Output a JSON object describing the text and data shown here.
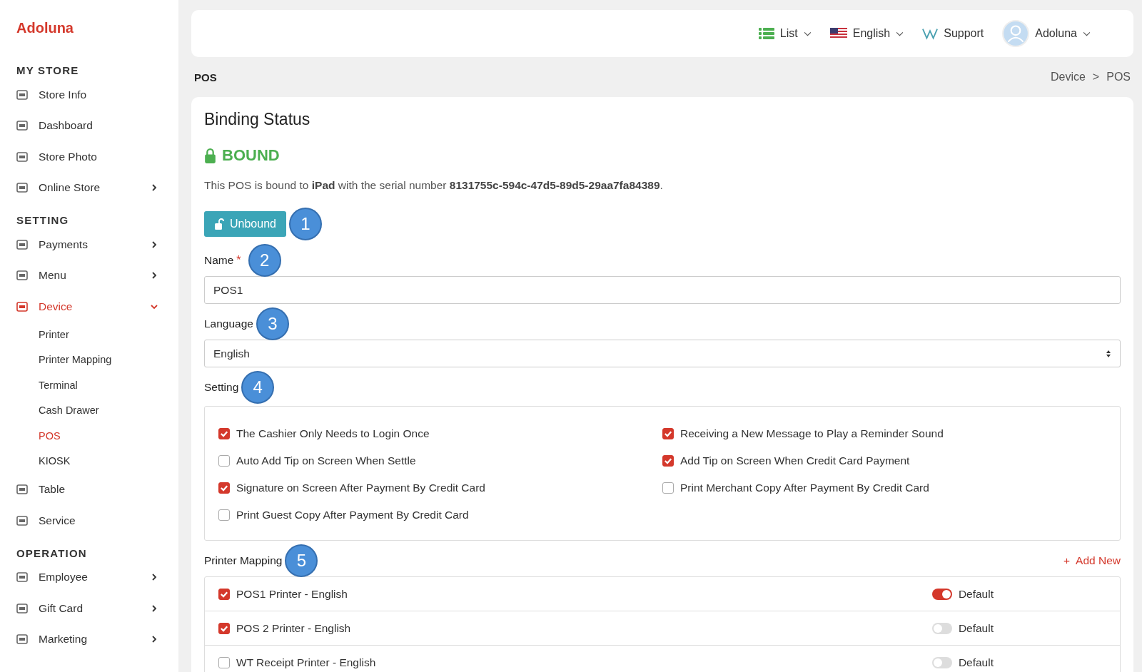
{
  "brand": "Adoluna",
  "sidebar": [
    {
      "kind": "section",
      "label": "MY STORE"
    },
    {
      "kind": "item",
      "label": "Store Info",
      "chevron": false,
      "selected": false
    },
    {
      "kind": "item",
      "label": "Dashboard",
      "chevron": false,
      "selected": false
    },
    {
      "kind": "item",
      "label": "Store Photo",
      "chevron": false,
      "selected": false
    },
    {
      "kind": "item",
      "label": "Online Store",
      "chevron": true,
      "expanded": false,
      "selected": false
    },
    {
      "kind": "section",
      "label": "SETTING"
    },
    {
      "kind": "item",
      "label": "Payments",
      "chevron": true,
      "expanded": false,
      "selected": false
    },
    {
      "kind": "item",
      "label": "Menu",
      "chevron": true,
      "expanded": false,
      "selected": false
    },
    {
      "kind": "item",
      "label": "Device",
      "chevron": true,
      "expanded": true,
      "selected": true,
      "children": [
        {
          "label": "Printer",
          "selected": false
        },
        {
          "label": "Printer Mapping",
          "selected": false
        },
        {
          "label": "Terminal",
          "selected": false
        },
        {
          "label": "Cash Drawer",
          "selected": false
        },
        {
          "label": "POS",
          "selected": true
        },
        {
          "label": "KIOSK",
          "selected": false
        }
      ]
    },
    {
      "kind": "item",
      "label": "Table",
      "chevron": false,
      "selected": false
    },
    {
      "kind": "item",
      "label": "Service",
      "chevron": false,
      "selected": false
    },
    {
      "kind": "section",
      "label": "OPERATION"
    },
    {
      "kind": "item",
      "label": "Employee",
      "chevron": true,
      "expanded": false,
      "selected": false
    },
    {
      "kind": "item",
      "label": "Gift Card",
      "chevron": true,
      "expanded": false,
      "selected": false
    },
    {
      "kind": "item",
      "label": "Marketing",
      "chevron": true,
      "expanded": false,
      "selected": false
    }
  ],
  "topbar": {
    "view": "List",
    "language": "English",
    "support": "Support",
    "user": "Adoluna"
  },
  "page_title": "POS",
  "breadcrumb": [
    "Device",
    ">",
    "POS"
  ],
  "card": {
    "title": "Binding Status",
    "status": "BOUND",
    "description": "This POS is bound to **iPad** with the serial number **8131755c-594c-47d5-89d5-29aa7fa84389**.",
    "unbind_button": "Unbound",
    "unbind_callout": "1",
    "name_label": "Name",
    "name_required": "*",
    "name_callout": "2",
    "name_value": "POS1",
    "language_label": "Language",
    "language_callout": "3",
    "language_value": "English",
    "setting_label": "Setting",
    "setting_callout": "4",
    "settings": [
      {
        "label": "The Cashier Only Needs to Login Once",
        "checked": true
      },
      {
        "label": "Receiving a New Message to Play a Reminder Sound",
        "checked": true
      },
      {
        "label": "Auto Add Tip on Screen When Settle",
        "checked": false
      },
      {
        "label": "Add Tip on Screen When Credit Card Payment",
        "checked": true
      },
      {
        "label": "Signature on Screen After Payment By Credit Card",
        "checked": true
      },
      {
        "label": "Print Merchant Copy After Payment By Credit Card",
        "checked": false
      },
      {
        "label": "Print Guest Copy After Payment By Credit Card",
        "checked": false
      }
    ],
    "mapping_label": "Printer Mapping",
    "mapping_callout": "5",
    "add_new_icon": "+",
    "add_new": "Add New",
    "printers": [
      {
        "label": "POS1 Printer - English",
        "checked": true,
        "default_on": true,
        "default_label": "Default"
      },
      {
        "label": "POS 2 Printer - English",
        "checked": true,
        "default_on": false,
        "default_label": "Default"
      },
      {
        "label": "WT Receipt Printer - English",
        "checked": false,
        "default_on": false,
        "default_label": "Default"
      }
    ]
  }
}
